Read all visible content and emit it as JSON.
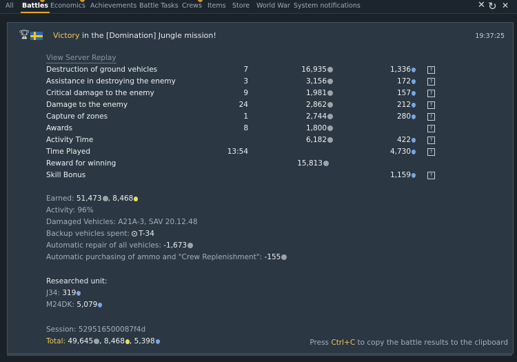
{
  "tabs": [
    {
      "label": "All",
      "active": false
    },
    {
      "label": "Battles",
      "active": true
    },
    {
      "label": "Economics",
      "active": false
    },
    {
      "label": "Achievements",
      "active": false
    },
    {
      "label": "Battle Tasks",
      "active": false
    },
    {
      "label": "Crews",
      "active": false
    },
    {
      "label": "Items",
      "active": false
    },
    {
      "label": "Store",
      "active": false
    },
    {
      "label": "World War",
      "active": false
    },
    {
      "label": "System notifications",
      "active": false
    }
  ],
  "message": {
    "title_prefix": "Victory",
    "title_rest": " in the [Domination] Jungle mission!",
    "time": "19:37:25",
    "replay_link": "View Server Replay",
    "rows": [
      {
        "label": "Destruction of ground vehicles",
        "count": "7",
        "silver": "16,935",
        "rp": "1,336",
        "help": "?"
      },
      {
        "label": "Assistance in destroying the enemy",
        "count": "3",
        "silver": "3,156",
        "rp": "172",
        "help": "?"
      },
      {
        "label": "Critical damage to the enemy",
        "count": "9",
        "silver": "1,981",
        "rp": "157",
        "help": "?"
      },
      {
        "label": "Damage to the enemy",
        "count": "24",
        "silver": "2,862",
        "rp": "212",
        "help": "?"
      },
      {
        "label": "Capture of zones",
        "count": "1",
        "silver": "2,744",
        "rp": "280",
        "help": "?"
      },
      {
        "label": "Awards",
        "count": "8",
        "silver": "1,800",
        "rp": "",
        "help": "?"
      },
      {
        "label": "Activity Time",
        "count": "",
        "silver": "6,182",
        "rp": "422",
        "help": "?"
      },
      {
        "label": "Time Played",
        "count": "13:54",
        "silver": "",
        "rp": "4,730",
        "help": "?"
      },
      {
        "label": "Reward for winning",
        "count": "",
        "silver": "15,813",
        "rp": "",
        "help": ""
      },
      {
        "label": "Skill Bonus",
        "count": "",
        "silver": "",
        "rp": "1,159",
        "help": "?"
      }
    ],
    "earned_label": "Earned: ",
    "earned_silver": "51,473",
    "earned_sep": ", ",
    "earned_gold": "8,468",
    "activity": "Activity: 96%",
    "damaged": "Damaged Vehicles: A21A-3, SAV 20.12.48",
    "backup_label": "Backup vehicles spent: ",
    "backup_value": "T-34",
    "repair_label": "Automatic repair of all vehicles: ",
    "repair_value": "-1,673",
    "ammo_label": "Automatic purchasing of ammo and \"Crew Replenishment\": ",
    "ammo_value": "-155",
    "researched_label": "Researched unit:",
    "researched": [
      {
        "name": "J34: ",
        "rp": "319"
      },
      {
        "name": "M24DK: ",
        "rp": "5,079"
      }
    ],
    "session": "Session: 529516500087f4d",
    "total_label": "Total: ",
    "total_silver": "49,645",
    "total_sep1": ", ",
    "total_gold": "8,468",
    "total_sep2": ", ",
    "total_rp": "5,398",
    "hint_pre": "Press ",
    "hint_key": "Ctrl+C",
    "hint_post": " to copy the battle results to the clipboard"
  },
  "icons": {
    "silver": "silver-lions-icon",
    "rp": "research-points-icon",
    "gold": "golden-eagles-icon",
    "trophy": "trophy-icon",
    "flag": "sweden-flag-icon",
    "close": "close-icon",
    "refresh": "refresh-icon"
  },
  "colors": {
    "accent": "#f2c85b",
    "rp_blue": "#74a8ea",
    "gold_yellow": "#e6e25a",
    "panel_bg": "#2b3742"
  }
}
